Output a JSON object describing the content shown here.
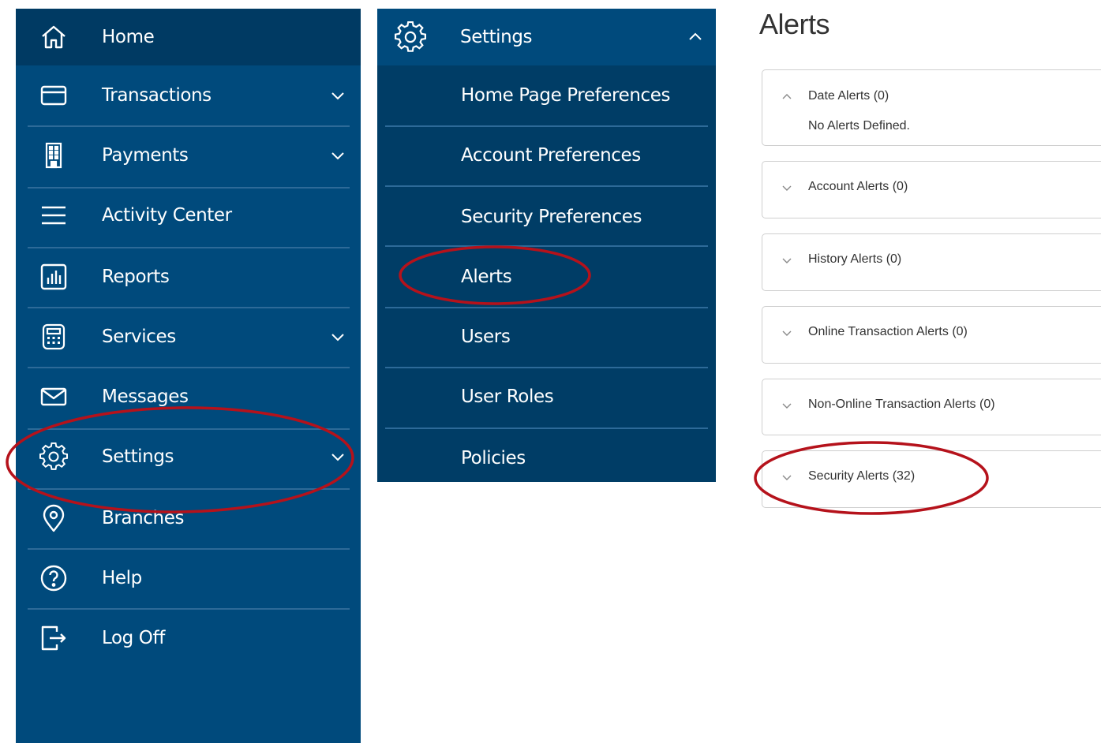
{
  "sidebar": {
    "items": [
      {
        "label": "Home",
        "icon": "home-icon"
      },
      {
        "label": "Transactions",
        "icon": "credit-card-icon",
        "has_chevron": true
      },
      {
        "label": "Payments",
        "icon": "building-icon",
        "has_chevron": true
      },
      {
        "label": "Activity Center",
        "icon": "hamburger-menu-icon"
      },
      {
        "label": "Reports",
        "icon": "bar-chart-icon"
      },
      {
        "label": "Services",
        "icon": "calculator-icon",
        "has_chevron": true
      },
      {
        "label": "Messages",
        "icon": "envelope-icon"
      },
      {
        "label": "Settings",
        "icon": "gear-icon",
        "has_chevron": true
      },
      {
        "label": "Branches",
        "icon": "map-pin-icon"
      },
      {
        "label": "Help",
        "icon": "question-circle-icon"
      },
      {
        "label": "Log Off",
        "icon": "logout-icon"
      }
    ]
  },
  "settings_menu": {
    "header": {
      "label": "Settings",
      "icon": "gear-icon",
      "state": "expanded"
    },
    "items": [
      {
        "label": "Home Page Preferences"
      },
      {
        "label": "Account Preferences"
      },
      {
        "label": "Security Preferences"
      },
      {
        "label": "Alerts"
      },
      {
        "label": "Users"
      },
      {
        "label": "User Roles"
      },
      {
        "label": "Policies"
      }
    ]
  },
  "alerts_page": {
    "title": "Alerts",
    "groups": [
      {
        "label": "Date Alerts (0)",
        "expanded": true,
        "empty_message": "No Alerts Defined."
      },
      {
        "label": "Account Alerts (0)",
        "expanded": false
      },
      {
        "label": "History Alerts (0)",
        "expanded": false
      },
      {
        "label": "Online Transaction Alerts (0)",
        "expanded": false
      },
      {
        "label": "Non-Online Transaction Alerts (0)",
        "expanded": false
      },
      {
        "label": "Security Alerts (32)",
        "expanded": false
      }
    ]
  },
  "colors": {
    "sidebar_bg": "#004a7c",
    "sidebar_active_bg": "#003a63",
    "submenu_bg": "#003d66",
    "divider": "#2d6a98",
    "annotation_red": "#b5121b"
  }
}
